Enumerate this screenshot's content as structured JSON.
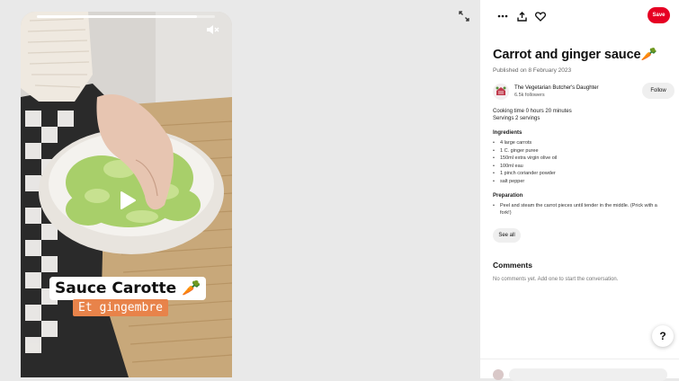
{
  "video": {
    "progress": 0.9,
    "caption_line1": "Sauce Carotte 🥕",
    "caption_line2": "Et gingembre",
    "icons": {
      "mute": "mute-icon",
      "play": "play-icon",
      "expand": "expand-icon"
    }
  },
  "toolbar": {
    "more_icon": "more-dots-icon",
    "share_icon": "share-icon",
    "like_icon": "heart-icon",
    "save_label": "Save"
  },
  "pin": {
    "title": "Carrot and ginger sauce🥕",
    "published": "Published on 8 February 2023"
  },
  "author": {
    "name": "The Vegetarian Butcher's Daughter",
    "followers": "6.5k followers",
    "follow_label": "Follow"
  },
  "recipe": {
    "cooking_time": "Cooking time 0 hours 20 minutes",
    "servings": "Servings 2 servings",
    "ingredients_label": "Ingredients",
    "ingredients": [
      "4 large carrots",
      "1 C. ginger puree",
      "150ml extra virgin olive oil",
      "100ml eau",
      "1 pinch coriander powder",
      "salt pepper"
    ],
    "preparation_label": "Preparation",
    "preparation": [
      "Peel and steam the carrot pieces until tender in the middle. (Prick with a fork!)"
    ],
    "see_all_label": "See all"
  },
  "comments": {
    "title": "Comments",
    "empty_text": "No comments yet. Add one to start the conversation."
  },
  "help_label": "?",
  "colors": {
    "save": "#e60023",
    "caption_orange": "#e8834a",
    "panel_bg": "#ffffff",
    "page_bg": "#e9e9e9"
  }
}
